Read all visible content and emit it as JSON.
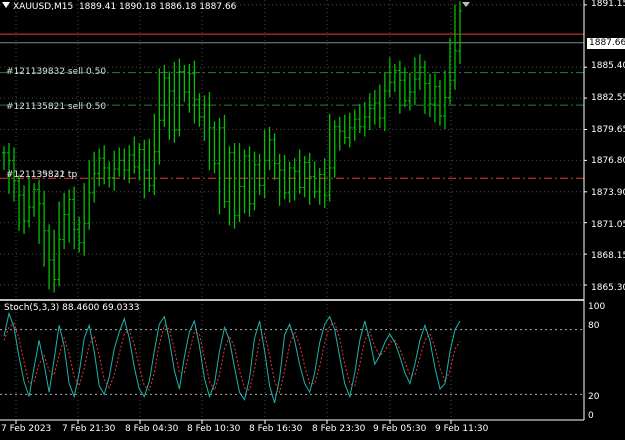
{
  "header": {
    "symbol": "XAUUSD,M15",
    "ohlc": "1889.41 1890.18 1886.18 1887.66"
  },
  "price_axis": {
    "labels": [
      "1891.15",
      "1885.40",
      "1882.55",
      "1879.65",
      "1876.80",
      "1873.90",
      "1871.05",
      "1868.15",
      "1865.30"
    ],
    "current_price": "1887.66",
    "current_price_bg": "#ffffff",
    "current_price_fg": "#000000"
  },
  "orders": [
    {
      "label": "#121139832 sell 0.50",
      "price": 1884.9,
      "style": "dashdot",
      "color": "#2e7d32"
    },
    {
      "label": "#121135821 sell 0.50",
      "price": 1881.9,
      "style": "dashdot",
      "color": "#2e7d32"
    },
    {
      "label": "#121135821 tp",
      "overlay_label": "#121139832 tp",
      "price": 1875.15,
      "style": "dashdot",
      "color": "#e53935"
    }
  ],
  "ask_line": {
    "price": 1888.45,
    "color": "#e53935"
  },
  "bid_line": {
    "price": 1887.66,
    "color": "#888888"
  },
  "oscillator": {
    "label": "Stoch(5,3,3) 88.4600 69.0333",
    "levels": [
      "100",
      "80",
      "20",
      "0"
    ]
  },
  "time_axis": {
    "labels": [
      "7 Feb 2023",
      "7 Feb 21:30",
      "8 Feb 04:30",
      "8 Feb 10:30",
      "8 Feb 16:30",
      "8 Feb 23:30",
      "9 Feb 05:30",
      "9 Feb 11:30"
    ]
  },
  "colors": {
    "background": "#000000",
    "candles": "#00c000",
    "grid": "#4a4a4a",
    "stoch_main": "#20b2aa",
    "stoch_signal": "#e53935",
    "separator": "#ffffff"
  },
  "chart_data": {
    "type": "line",
    "title": "XAUUSD,M15",
    "series": [
      {
        "name": "XAUUSD",
        "values": [
          1877.5,
          1876.8,
          1874.9,
          1873.6,
          1871.2,
          1872.5,
          1874.1,
          1872.8,
          1870.3,
          1867.6,
          1865.8,
          1869.5,
          1871.8,
          1873.2,
          1870.4,
          1869.2,
          1871.0,
          1873.8,
          1875.6,
          1877.0,
          1876.1,
          1875.2,
          1876.0,
          1876.8,
          1875.9,
          1877.3,
          1876.2,
          1877.8,
          1875.9,
          1874.5,
          1877.6,
          1880.5,
          1884.4,
          1883.2,
          1879.6,
          1885.0,
          1883.1,
          1884.8,
          1882.4,
          1880.8,
          1881.9,
          1879.8,
          1876.5,
          1879.8,
          1873.0,
          1877.5,
          1871.7,
          1874.4,
          1877.2,
          1872.8,
          1876.4,
          1874.5,
          1876.8,
          1878.7,
          1876.5,
          1875.9,
          1873.8,
          1876.1,
          1875.8,
          1874.3,
          1876.6,
          1875.3,
          1873.9,
          1875.5,
          1873.6,
          1876.1,
          1879.9,
          1879.5,
          1878.9,
          1879.8,
          1880.6,
          1879.9,
          1880.8,
          1881.6,
          1882.1,
          1880.7,
          1883.2,
          1884.0,
          1885.1,
          1884.2,
          1882.3,
          1883.1,
          1884.3,
          1885.4,
          1883.9,
          1882.0,
          1883.6,
          1880.9,
          1882.6,
          1884.2,
          1886.9,
          1890.6
        ]
      },
      {
        "name": "Stoch main",
        "values": [
          74,
          95,
          82,
          55,
          32,
          18,
          45,
          70,
          48,
          22,
          52,
          84,
          65,
          30,
          18,
          40,
          72,
          84,
          60,
          28,
          20,
          36,
          62,
          78,
          90,
          72,
          45,
          25,
          18,
          32,
          60,
          85,
          92,
          70,
          42,
          25,
          55,
          78,
          88,
          65,
          35,
          18,
          30,
          60,
          82,
          70,
          45,
          22,
          15,
          35,
          72,
          88,
          60,
          28,
          12,
          35,
          75,
          85,
          70,
          48,
          30,
          22,
          40,
          68,
          85,
          92,
          80,
          55,
          30,
          18,
          40,
          70,
          88,
          70,
          48,
          56,
          68,
          76,
          68,
          55,
          40,
          30,
          48,
          70,
          84,
          70,
          45,
          25,
          30,
          60,
          80,
          88
        ]
      },
      {
        "name": "Stoch signal",
        "values": [
          70,
          82,
          86,
          72,
          50,
          30,
          32,
          48,
          56,
          42,
          38,
          56,
          72,
          58,
          36,
          28,
          44,
          66,
          74,
          56,
          34,
          26,
          38,
          58,
          76,
          80,
          66,
          46,
          28,
          24,
          40,
          66,
          84,
          80,
          62,
          40,
          40,
          60,
          78,
          76,
          54,
          32,
          24,
          38,
          62,
          74,
          64,
          42,
          26,
          24,
          44,
          70,
          76,
          56,
          32,
          22,
          42,
          66,
          78,
          66,
          46,
          30,
          30,
          46,
          68,
          84,
          86,
          72,
          48,
          30,
          28,
          48,
          70,
          78,
          64,
          56,
          60,
          68,
          70,
          62,
          50,
          38,
          38,
          54,
          70,
          76,
          64,
          44,
          32,
          42,
          62,
          69
        ]
      }
    ]
  }
}
